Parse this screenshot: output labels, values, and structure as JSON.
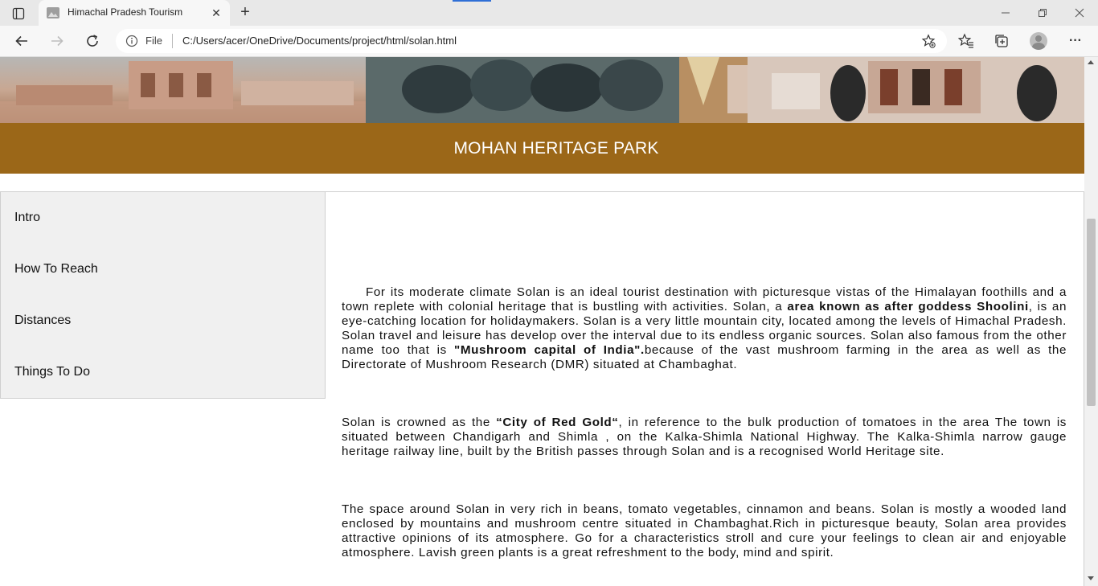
{
  "browser": {
    "tab_title": "Himachal Pradesh Tourism",
    "tab_close": "✕",
    "new_tab": "+",
    "address_label": "File",
    "url": "C:/Users/acer/OneDrive/Documents/project/html/solan.html",
    "more": "···"
  },
  "banner": {
    "title": "MOHAN HERITAGE PARK"
  },
  "sidebar": {
    "items": [
      {
        "label": "Intro"
      },
      {
        "label": "How To Reach"
      },
      {
        "label": "Distances"
      },
      {
        "label": "Things To Do"
      }
    ]
  },
  "content": {
    "p1": {
      "a": "For its moderate climate Solan is an ideal tourist destination with picturesque vistas of the Himalayan foothills and a town replete with colonial heritage that is bustling with activities. Solan, a ",
      "b": "area known as after goddess Shoolini",
      "c": ", is an eye-catching location for holidaymakers. Solan is a very little mountain city, located among the levels of Himachal Pradesh. Solan travel and leisure has develop over the interval due to its endless organic sources. Solan also famous from the other name too that is ",
      "d": "\"Mushroom capital of India\".",
      "e": "because of the vast mushroom farming in the area as well as the Directorate of Mushroom Research (DMR) situated at Chambaghat."
    },
    "p2": {
      "a": "Solan is crowned as the ",
      "b": "“City of Red Gold“",
      "c": ", in reference to the bulk production of tomatoes in the area The town is situated between Chandigarh and Shimla , on the Kalka-Shimla National Highway. The Kalka-Shimla narrow gauge heritage railway line, built by the British passes through Solan and is a recognised World Heritage site."
    },
    "p3": "The space around Solan in very rich in beans, tomato vegetables, cinnamon and beans. Solan is mostly a wooded land enclosed by mountains and mushroom centre situated in Chambaghat.Rich in picturesque beauty, Solan area provides attractive opinions of its atmosphere. Go for a characteristics stroll and cure your feelings to clean air and enjoyable atmosphere. Lavish green plants is a great refreshment to the body, mind and spirit."
  }
}
